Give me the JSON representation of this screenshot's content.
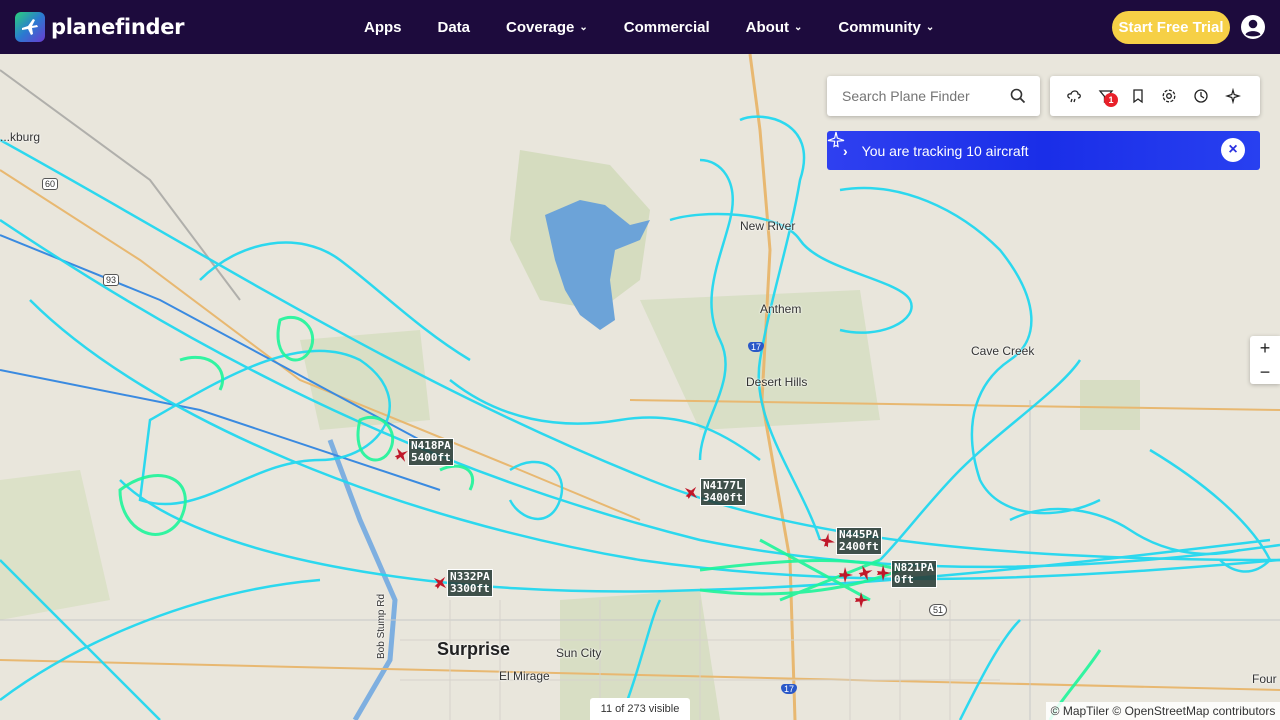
{
  "brand": {
    "name": "planefinder"
  },
  "nav": {
    "items": [
      {
        "label": "Apps",
        "dropdown": false
      },
      {
        "label": "Data",
        "dropdown": false
      },
      {
        "label": "Coverage",
        "dropdown": true
      },
      {
        "label": "Commercial",
        "dropdown": false
      },
      {
        "label": "About",
        "dropdown": true
      },
      {
        "label": "Community",
        "dropdown": true
      }
    ],
    "trial_button": "Start Free Trial"
  },
  "search": {
    "placeholder": "Search Plane Finder"
  },
  "toolbar": {
    "icons": [
      "weather-icon",
      "filter-icon",
      "bookmark-icon",
      "settings-icon",
      "history-icon",
      "3d-view-icon"
    ],
    "filter_badge": "1"
  },
  "tracking": {
    "text": "You are tracking 10 aircraft",
    "arrow": "›",
    "close": "×"
  },
  "zoom": {
    "in": "+",
    "out": "−"
  },
  "map": {
    "places": [
      {
        "name": "...kburg",
        "big": false
      },
      {
        "name": "New River",
        "big": false
      },
      {
        "name": "Anthem",
        "big": false
      },
      {
        "name": "Cave Creek",
        "big": false
      },
      {
        "name": "Desert Hills",
        "big": false
      },
      {
        "name": "Surprise",
        "big": true
      },
      {
        "name": "Sun City",
        "big": false
      },
      {
        "name": "El Mirage",
        "big": false
      },
      {
        "name": "Four",
        "big": false
      },
      {
        "name": "Bob Stump Rd",
        "big": false
      }
    ],
    "aircraft": [
      {
        "callsign": "N418PA",
        "altitude": "5400ft"
      },
      {
        "callsign": "N4177L",
        "altitude": "3400ft"
      },
      {
        "callsign": "N445PA",
        "altitude": "2400ft"
      },
      {
        "callsign": "N821PA",
        "altitude": "0ft"
      },
      {
        "callsign": "N332PA",
        "altitude": "3300ft"
      }
    ],
    "highways": [
      "60",
      "93",
      "51",
      "17",
      "17"
    ],
    "track_colors": {
      "primary": "#22d8f0",
      "low": "#1ef59a",
      "route": "#3a8ae0"
    }
  },
  "visible_count": "11 of 273 visible",
  "attribution": "© MapTiler © OpenStreetMap contributors"
}
